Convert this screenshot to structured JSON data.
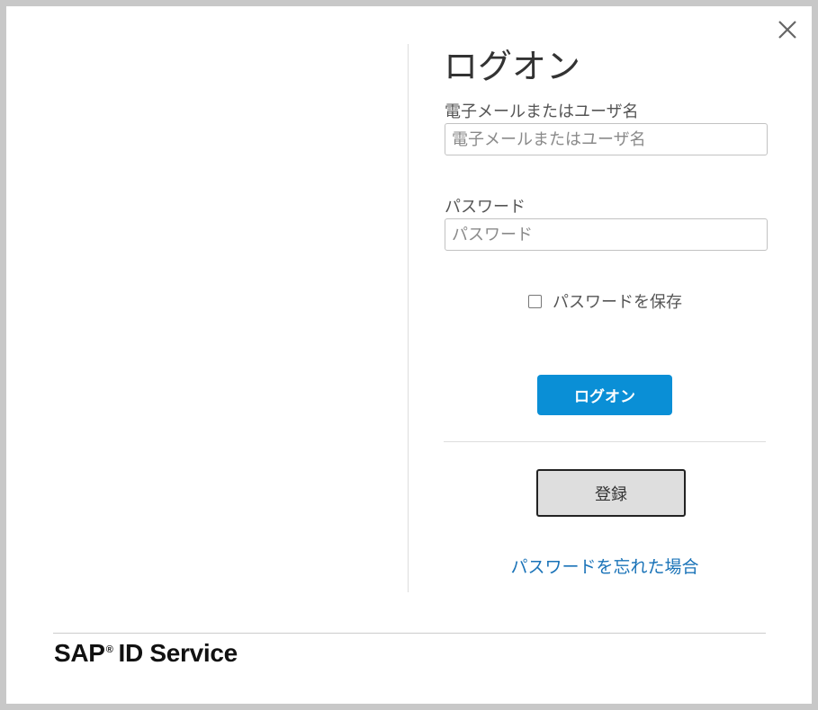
{
  "dialog": {
    "close_icon": "close-icon",
    "title": "ログオン",
    "username": {
      "label": "電子メールまたはユーザ名",
      "placeholder": "電子メールまたはユーザ名",
      "value": ""
    },
    "password": {
      "label": "パスワード",
      "placeholder": "パスワード",
      "value": ""
    },
    "remember": {
      "label": "パスワードを保存",
      "checked": false
    },
    "logon_button": "ログオン",
    "register_button": "登録",
    "forgot_link": "パスワードを忘れた場合"
  },
  "footer": {
    "brand_sap": "SAP",
    "brand_reg": "®",
    "brand_service": "ID Service"
  },
  "colors": {
    "primary_button": "#0a8fd6",
    "link": "#1a73b8",
    "backdrop": "#c8c8c8"
  }
}
